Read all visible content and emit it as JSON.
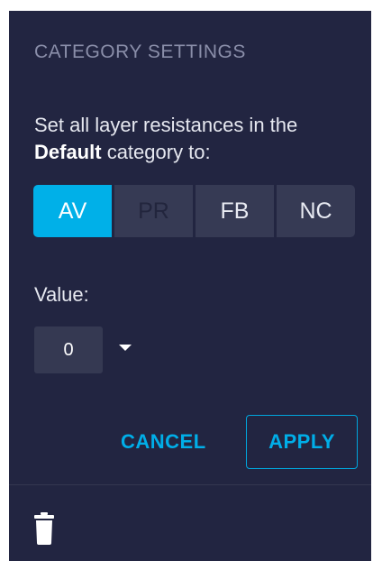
{
  "dialog": {
    "title": "CATEGORY SETTINGS",
    "description_prefix": "Set all layer resistances in the",
    "description_category": "Default",
    "description_suffix": "category to:"
  },
  "resistance_buttons": [
    {
      "label": "AV",
      "state": "selected"
    },
    {
      "label": "PR",
      "state": "disabled"
    },
    {
      "label": "FB",
      "state": "normal"
    },
    {
      "label": "NC",
      "state": "normal"
    }
  ],
  "value_field": {
    "label": "Value:",
    "value": "0"
  },
  "actions": {
    "cancel_label": "CANCEL",
    "apply_label": "APPLY"
  },
  "icons": {
    "dropdown": "caret-down-icon",
    "delete": "trash-icon"
  },
  "colors": {
    "panel_background": "#222541",
    "accent": "#00b0e8",
    "button_background": "#363a54"
  }
}
